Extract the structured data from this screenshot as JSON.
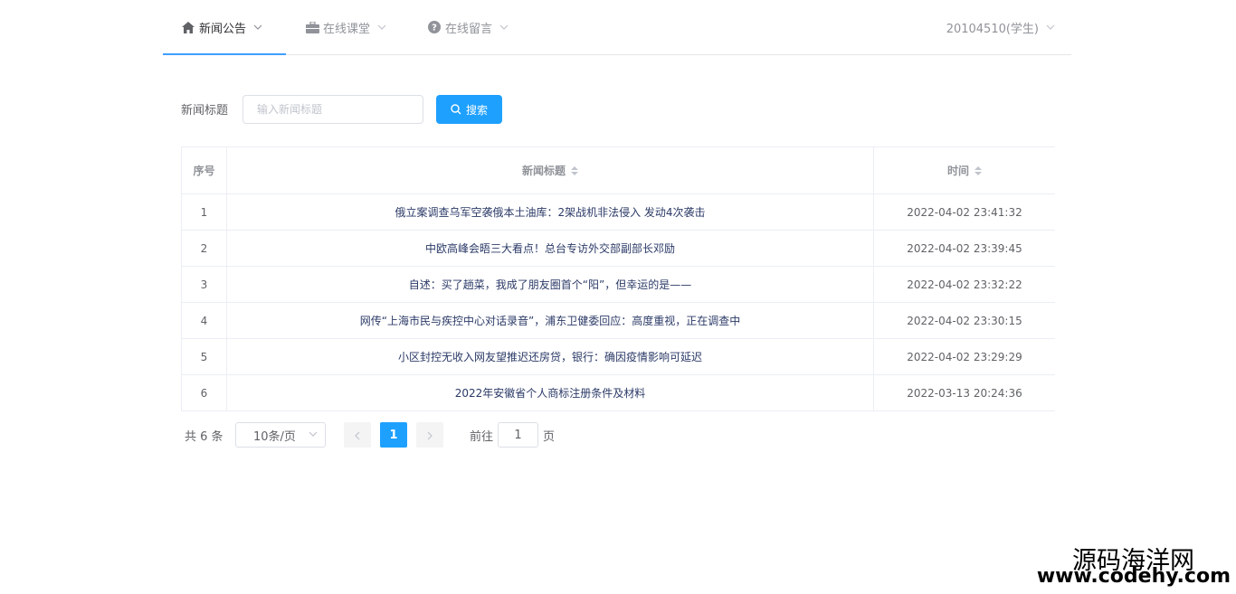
{
  "nav": {
    "items": [
      {
        "label": "新闻公告",
        "icon": "home-icon",
        "active": true
      },
      {
        "label": "在线课堂",
        "icon": "briefcase-icon",
        "active": false
      },
      {
        "label": "在线留言",
        "icon": "question-circle-icon",
        "active": false
      }
    ],
    "user": "20104510(学生)"
  },
  "search": {
    "label": "新闻标题",
    "placeholder": "输入新闻标题",
    "value": "",
    "button_label": "搜索"
  },
  "table": {
    "headers": {
      "index": "序号",
      "title": "新闻标题",
      "time": "时间"
    },
    "rows": [
      {
        "index": "1",
        "title": "俄立案调查乌军空袭俄本土油库：2架战机非法侵入 发动4次袭击",
        "time": "2022-04-02 23:41:32"
      },
      {
        "index": "2",
        "title": "中欧高峰会晤三大看点！总台专访外交部副部长邓励",
        "time": "2022-04-02 23:39:45"
      },
      {
        "index": "3",
        "title": "自述：买了趟菜，我成了朋友圈首个“阳”，但幸运的是——",
        "time": "2022-04-02 23:32:22"
      },
      {
        "index": "4",
        "title": "网传“上海市民与疾控中心对话录音”，浦东卫健委回应：高度重视，正在调查中",
        "time": "2022-04-02 23:30:15"
      },
      {
        "index": "5",
        "title": "小区封控无收入网友望推迟还房贷，银行：确因疫情影响可延迟",
        "time": "2022-04-02 23:29:29"
      },
      {
        "index": "6",
        "title": "2022年安徽省个人商标注册条件及材料",
        "time": "2022-03-13 20:24:36"
      }
    ]
  },
  "pagination": {
    "total_text": "共 6 条",
    "page_size": "10条/页",
    "current_page": "1",
    "goto_label": "前往",
    "goto_value": "1",
    "goto_unit": "页"
  },
  "watermark": {
    "line1": "源码海洋网",
    "line2": "www.codehy.com"
  },
  "colors": {
    "accent": "#1ea0ff",
    "nav_underline": "#409eff",
    "title_link": "#2b3a67"
  }
}
